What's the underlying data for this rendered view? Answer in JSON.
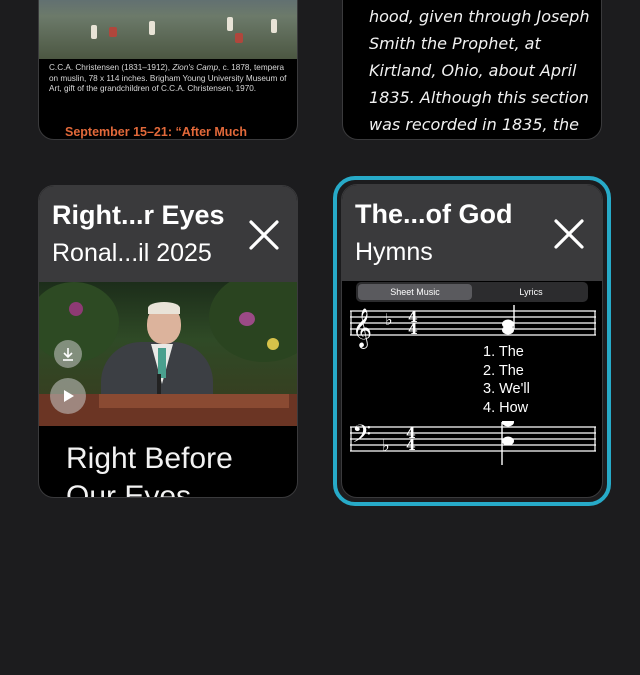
{
  "cards": {
    "top_left": {
      "caption_author": "C.C.A. Christensen (1831–1912), ",
      "caption_italic": "Zion's Camp",
      "caption_rest": ", c. 1878, tempera on muslin, 78 x 114 inches. Brigham Young University Museum of Art, gift of the grandchildren of C.C.A. Christensen, 1970.",
      "lesson": "September 15–21: “After Much"
    },
    "top_right": {
      "text": "hood, given through Joseph Smith the Prophet, at Kirtland, Ohio, about April 1835. Although this section was recorded in 1835, the"
    },
    "bottom_left": {
      "title": "Right...r Eyes",
      "subtitle": "Ronal...il 2025",
      "body_text": "Right Before Our Eyes"
    },
    "bottom_right": {
      "title": "The...of God",
      "subtitle": "Hymns",
      "segment": {
        "selected": "Sheet Music",
        "other": "Lyrics"
      },
      "verses": [
        "1. The",
        "2. The",
        "3. We'll",
        "4. How"
      ]
    }
  },
  "colors": {
    "background": "#1c1c1e",
    "card_header": "#3a3a3c",
    "selection": "#27aac8",
    "lesson_accent": "#e2693a"
  }
}
